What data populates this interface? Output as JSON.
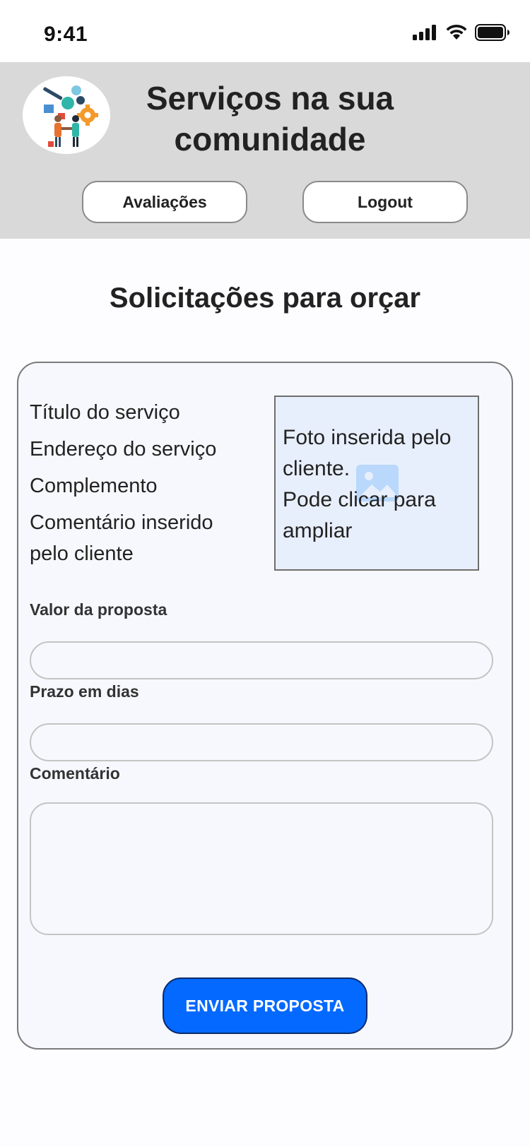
{
  "status_bar": {
    "time": "9:41"
  },
  "header": {
    "title": "Serviços na sua comunidade",
    "buttons": {
      "reviews": "Avaliações",
      "logout": "Logout"
    }
  },
  "page": {
    "title": "Solicitações para orçar"
  },
  "request": {
    "service_title": "Título do serviço",
    "service_address": "Endereço do serviço",
    "complement": "Complemento",
    "client_comment": "Comentário inserido pelo cliente",
    "photo_text": "Foto inserida pelo cliente.\nPode clicar para ampliar"
  },
  "form": {
    "value_label": "Valor da proposta",
    "value": "",
    "deadline_label": "Prazo em dias",
    "deadline": "",
    "comment_label": "Comentário",
    "comment": "",
    "submit_label": "ENVIAR PROPOSTA"
  },
  "colors": {
    "header_bg": "#d9d9d9",
    "accent": "#0469ff",
    "card_bg": "#f7f8fd",
    "photo_bg": "#e8effc"
  },
  "icons": [
    "signal-icon",
    "wifi-icon",
    "battery-icon",
    "logo-image",
    "image-placeholder-icon"
  ]
}
